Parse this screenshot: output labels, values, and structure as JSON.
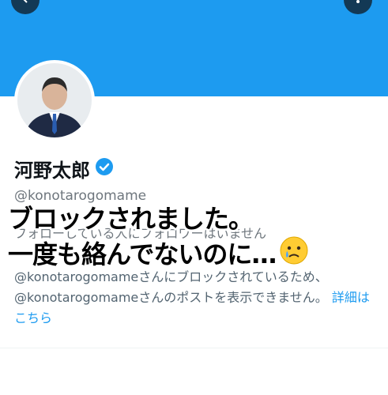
{
  "profile": {
    "name": "河野太郎",
    "handle": "@konotarogomame",
    "follow_note": "フォローしている人にフォロワーはいません"
  },
  "overlay": {
    "line1": "ブロックされました。",
    "line2": "一度も絡んでないのに…"
  },
  "blocked_notice": {
    "text": "@konotarogomameさんにブロックされているため、@konotarogomameさんのポストを表示できません。",
    "link": "詳細はこちら"
  },
  "colors": {
    "banner": "#1d9bf0",
    "verified": "#1d9bf0",
    "link": "#1d9bf0"
  },
  "icons": [
    "back-arrow-icon",
    "more-icon",
    "verified-badge-icon",
    "crying-face-icon"
  ]
}
